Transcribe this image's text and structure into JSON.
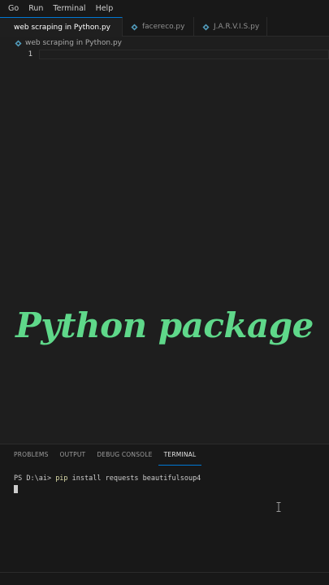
{
  "menu": {
    "items": [
      "Go",
      "Run",
      "Terminal",
      "Help"
    ]
  },
  "tabs": [
    {
      "label": "web scraping in Python.py",
      "active": true,
      "modified": true
    },
    {
      "label": "facereco.py",
      "active": false,
      "modified": false
    },
    {
      "label": "J.A.R.V.I.S.py",
      "active": false,
      "modified": false
    }
  ],
  "breadcrumb": {
    "file": "web scraping in Python.py"
  },
  "editor": {
    "line_numbers": [
      "1"
    ],
    "overlay_title": "Python package"
  },
  "panel": {
    "tabs": [
      "PROBLEMS",
      "OUTPUT",
      "DEBUG CONSOLE",
      "TERMINAL"
    ],
    "active_tab": "TERMINAL",
    "terminal": {
      "prompt": "PS D:\\ai> ",
      "command": "pip",
      "args": " install requests beautifulsoup4"
    }
  },
  "colors": {
    "accent": "#0078d4",
    "overlay_text": "#5fd88a",
    "editor_bg": "#1e1e1e",
    "python_icon": "#519aba"
  },
  "icons": {
    "python_file": "python-file-icon",
    "modified": "modified-dot-icon",
    "text_cursor": "ibeam-cursor-icon"
  }
}
